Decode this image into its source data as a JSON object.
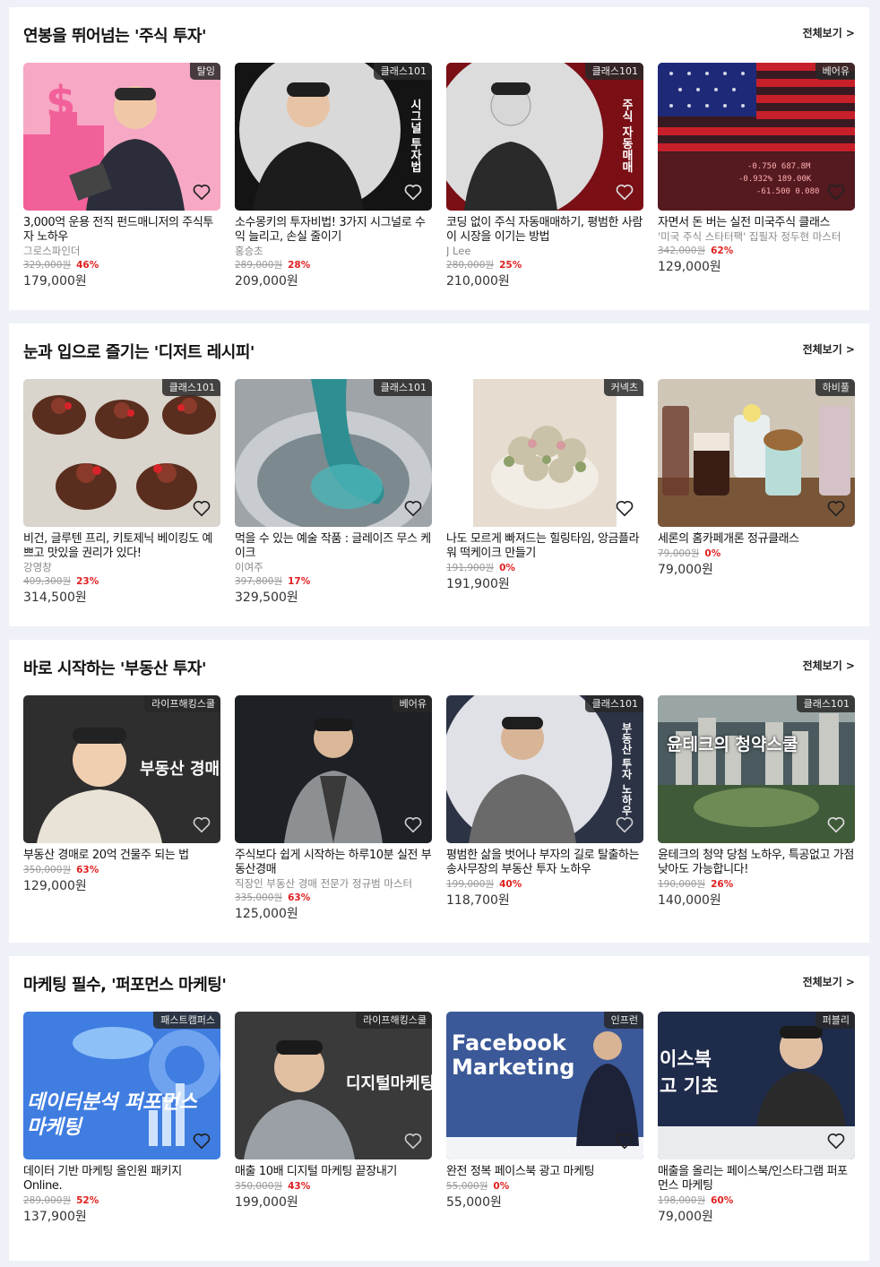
{
  "common": {
    "see_all": "전체보기 >"
  },
  "sections": [
    {
      "title": "연봉을 뛰어넘는 '주식 투자'",
      "cards": [
        {
          "badge": "탈잉",
          "title": "3,000억 운용 전직 펀드매니저의 주식투자 노하우",
          "author": "그로스파인더",
          "orig": "329,000원",
          "disc": "46%",
          "price": "179,000원",
          "overlay": ""
        },
        {
          "badge": "클래스101",
          "title": "소수몽키의 투자비법! 3가지 시그널로 수익 늘리고, 손실 줄이기",
          "author": "홍승초",
          "orig": "289,000원",
          "disc": "28%",
          "price": "209,000원",
          "overlay": "시그널 투자법"
        },
        {
          "badge": "클래스101",
          "title": "코딩 없이 주식 자동매매하기, 평범한 사람이 시장을 이기는 방법",
          "author": "J Lee",
          "orig": "280,000원",
          "disc": "25%",
          "price": "210,000원",
          "overlay": "주식 자동매매"
        },
        {
          "badge": "베어유",
          "title": "자면서 돈 버는 실전 미국주식 클래스",
          "author": "'미국 주식 스타터팩' 집필자 정두현 마스터",
          "orig": "342,000원",
          "disc": "62%",
          "price": "129,000원",
          "overlay": ""
        }
      ]
    },
    {
      "title": "눈과 입으로 즐기는 '디저트 레시피'",
      "cards": [
        {
          "badge": "클래스101",
          "title": "비건, 글루텐 프리, 키토제닉 베이킹도 예쁘고 맛있을 권리가 있다!",
          "author": "강영창",
          "orig": "409,300원",
          "disc": "23%",
          "price": "314,500원",
          "overlay": ""
        },
        {
          "badge": "클래스101",
          "title": "먹을 수 있는 예술 작품 : 글레이즈 무스 케이크",
          "author": "이여주",
          "orig": "397,800원",
          "disc": "17%",
          "price": "329,500원",
          "overlay": ""
        },
        {
          "badge": "커넥츠",
          "title": "나도 모르게 빠져드는 힐링타임, 앙금플라워 떡케이크 만들기",
          "author": "",
          "orig": "191,900원",
          "disc": "0%",
          "price": "191,900원",
          "overlay": ""
        },
        {
          "badge": "하비풀",
          "title": "세론의 홈카페개론 정규클래스",
          "author": "",
          "orig": "79,000원",
          "disc": "0%",
          "price": "79,000원",
          "overlay": ""
        }
      ]
    },
    {
      "title": "바로 시작하는 '부동산 투자'",
      "cards": [
        {
          "badge": "라이프해킹스쿨",
          "title": "부동산 경매로 20억 건물주 되는 법",
          "author": "",
          "orig": "350,000원",
          "disc": "63%",
          "price": "129,000원",
          "overlay": "부동산 경매"
        },
        {
          "badge": "베어유",
          "title": "주식보다 쉽게 시작하는 하루10분 실전 부동산경매",
          "author": "직장인 부동산 경매 전문가 정규범 마스터",
          "orig": "335,000원",
          "disc": "63%",
          "price": "125,000원",
          "overlay": ""
        },
        {
          "badge": "클래스101",
          "title": "평범한 삶을 벗어나 부자의 길로 탈출하는 송사무장의 부동산 투자 노하우",
          "author": "",
          "orig": "199,000원",
          "disc": "40%",
          "price": "118,700원",
          "overlay": "부동산 투자 노하우"
        },
        {
          "badge": "클래스101",
          "title": "윤테크의 청약 당첨 노하우, 특공없고 가점 낮아도 가능합니다!",
          "author": "",
          "orig": "190,000원",
          "disc": "26%",
          "price": "140,000원",
          "overlay": "윤테크의 청약스쿨"
        }
      ]
    },
    {
      "title": "마케팅 필수, '퍼포먼스 마케팅'",
      "cards": [
        {
          "badge": "패스트캠퍼스",
          "title": "데이터 기반 마케팅 올인원 패키지 Online.",
          "author": "",
          "orig": "289,000원",
          "disc": "52%",
          "price": "137,900원",
          "overlay": "데이터분석 퍼포먼스마케팅"
        },
        {
          "badge": "라이프해킹스쿨",
          "title": "매출 10배 디지털 마케팅 끝장내기",
          "author": "",
          "orig": "350,000원",
          "disc": "43%",
          "price": "199,000원",
          "overlay": "디지털마케팅"
        },
        {
          "badge": "인프런",
          "title": "완전 정복 페이스북 광고 마케팅",
          "author": "",
          "orig": "55,000원",
          "disc": "0%",
          "price": "55,000원",
          "overlay": "Facebook Marketing"
        },
        {
          "badge": "퍼블리",
          "title": "매출을 올리는 페이스북/인스타그램 퍼포먼스 마케팅",
          "author": "",
          "orig": "198,000원",
          "disc": "60%",
          "price": "79,000원",
          "overlay": "이스북 고 기초"
        }
      ]
    }
  ]
}
